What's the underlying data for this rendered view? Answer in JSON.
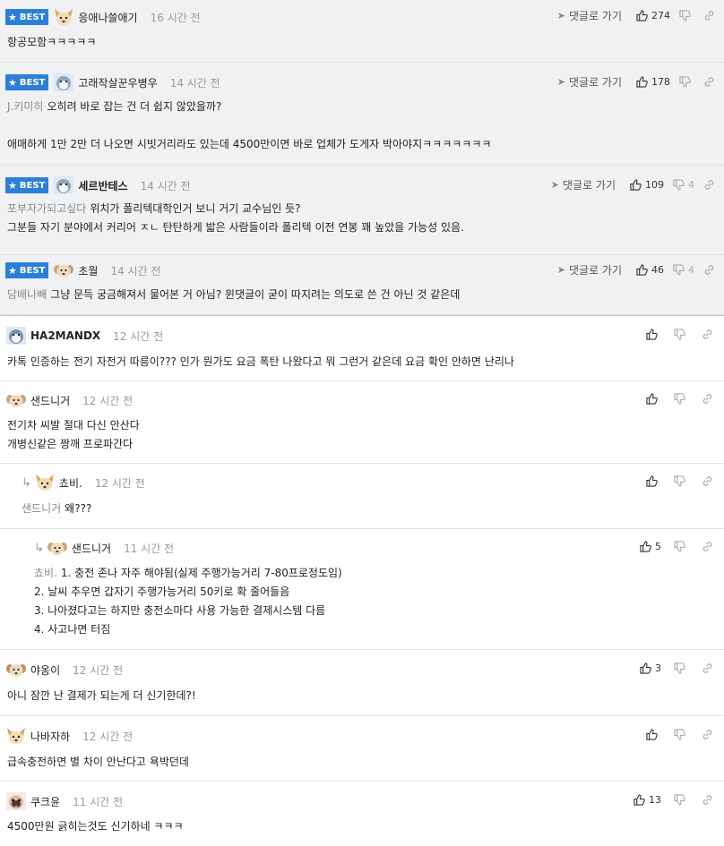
{
  "labels": {
    "best": "BEST",
    "reply_link": "댓글로 가기"
  },
  "colors": {
    "best_badge": "#2c7fd8",
    "best_bg": "#f0f1f3",
    "mention": "#8a8a8a",
    "time": "#999999"
  },
  "comments": [
    {
      "nick": "응애나쓸애기",
      "time": "16 시간 전",
      "up": "274",
      "down": "",
      "avatar": "dog",
      "lines": [
        "항공모함ㅋㅋㅋㅋㅋ"
      ]
    },
    {
      "nick": "고래작살꾼우병우",
      "time": "14 시간 전",
      "up": "178",
      "down": "",
      "avatar": "husky",
      "mention": "J.키미히",
      "lines": [
        "오히려 바로 잡는 건 더 쉽지 않았을까?",
        "",
        "애매하게 1만 2만 더 나오면 시빗거리라도 있는데 4500만이면 바로 업체가 도게자 박아야지ㅋㅋㅋㅋㅋㅋㅋ"
      ]
    },
    {
      "nick": "세르반테스",
      "time": "14 시간 전",
      "up": "109",
      "down": "4",
      "avatar": "husky",
      "mention": "포부자가되고싶다",
      "lines": [
        "위치가 폴리텍대학인거 보니 거기 교수님인 듯?",
        "그분들 자기 분야에서 커리어 ㅈㄴ 탄탄하게 밟은 사람들이라 폴리텍 이전 연봉 꽤 높았을 가능성 있음."
      ]
    },
    {
      "nick": "초월",
      "time": "14 시간 전",
      "up": "46",
      "down": "4",
      "avatar": "puppy",
      "mention": "담배나빼",
      "lines": [
        "그냥 문득 궁금해져서 물어본 거 아님? 윈댓글이 굳이 따지려는 의도로 쓴 건 아닌 것 같은데"
      ]
    },
    {
      "nick": "HA2MANDX",
      "time": "12 시간 전",
      "up": "",
      "down": "",
      "avatar": "husky",
      "lines": [
        "카톡 인증하는 전기 자전거 따릉이??? 인가 뭔가도 요금 폭탄 나왔다고 뭐 그런거 같은데 요금 확인 안하면 난리나"
      ]
    },
    {
      "nick": "샌드니거",
      "time": "12 시간 전",
      "up": "",
      "down": "",
      "avatar": "puppy",
      "lines": [
        "전기차 씨발 절대 다신 안산다",
        "개병신같은 짱깨 프로파간다"
      ]
    },
    {
      "nick": "쵸비.",
      "time": "12 시간 전",
      "up": "",
      "down": "",
      "avatar": "dog",
      "mention": "샌드니거",
      "lines": [
        "왜???"
      ]
    },
    {
      "nick": "샌드니거",
      "time": "11 시간 전",
      "up": "5",
      "down": "",
      "avatar": "puppy",
      "mention": "쵸비.",
      "lines": [
        "1. 충전 존나 자주 해야됨(실제 주행가능거리 7-80프로정도임)",
        "2. 날씨 추우면 갑자기 주행가능거리 50키로 확 줄어들음",
        "3. 나아졌다고는 하지만 충전소마다 사용 가능한 결제시스템 다름",
        "4. 사고나면 터짐"
      ]
    },
    {
      "nick": "야옹이",
      "time": "12 시간 전",
      "up": "3",
      "down": "",
      "avatar": "puppy",
      "lines": [
        "아니 잠깐 난 결제가 되는게 더 신기한데?!"
      ]
    },
    {
      "nick": "나바자하",
      "time": "12 시간 전",
      "up": "",
      "down": "",
      "avatar": "dog",
      "lines": [
        "급속충전하면 별 차이 안난다고 욕박던데"
      ]
    },
    {
      "nick": "쿠크윤",
      "time": "11 시간 전",
      "up": "13",
      "down": "",
      "avatar": "pug",
      "lines": [
        "4500만원 긁히는것도 신기하네 ㅋㅋㅋ"
      ]
    }
  ]
}
